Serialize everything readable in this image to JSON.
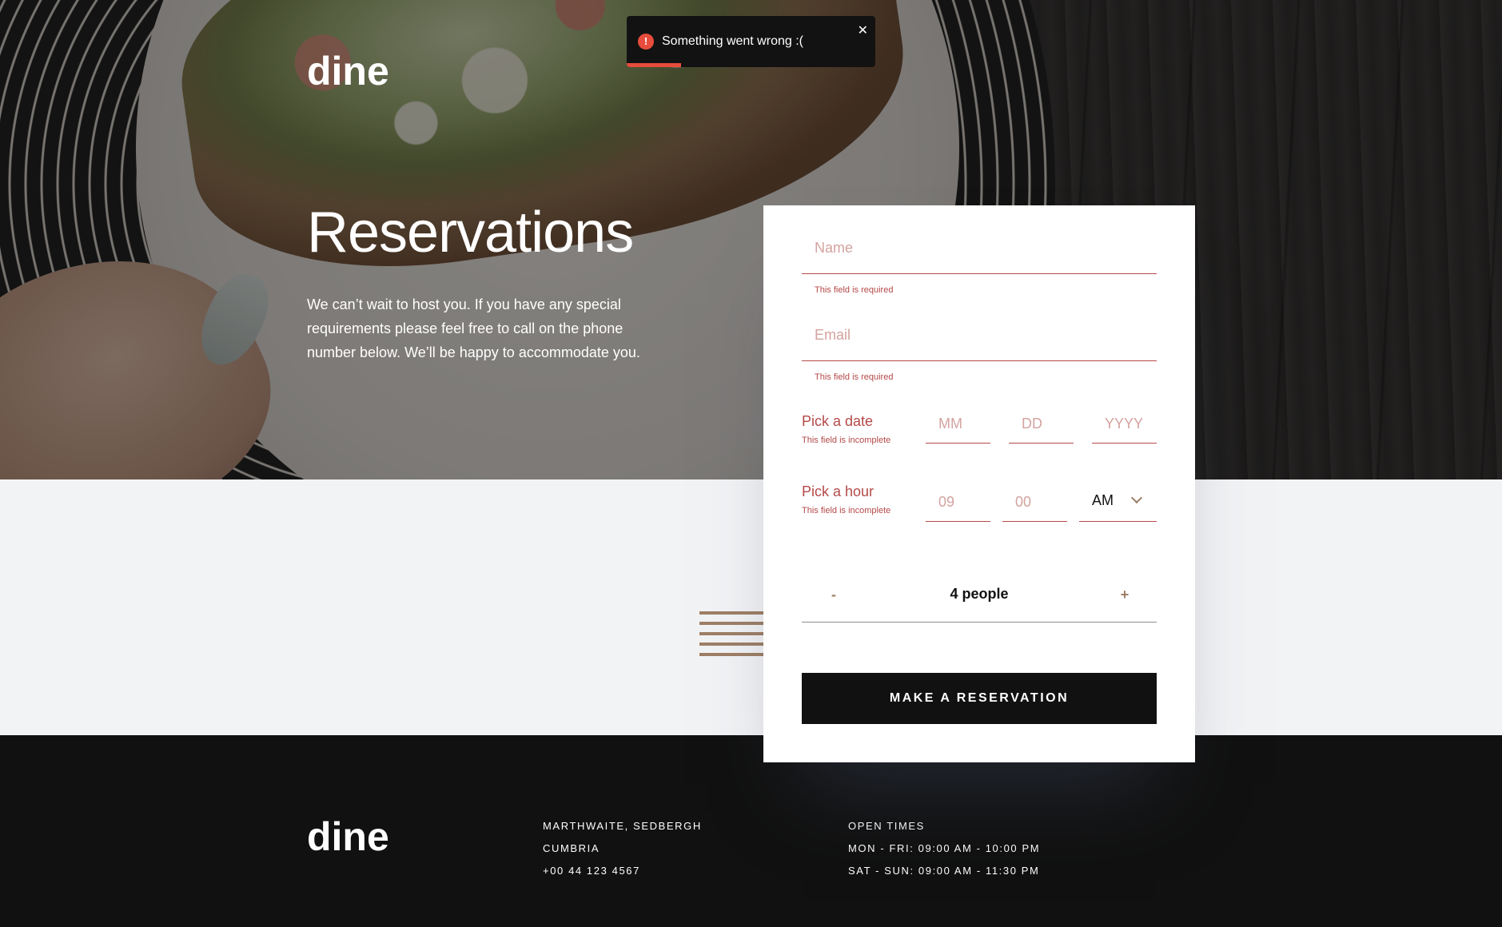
{
  "brand": {
    "logo": "dine"
  },
  "hero": {
    "title": "Reservations",
    "description": "We can’t wait to host you. If you have any special requirements please feel free to call on the phone number below. We’ll be happy to accommodate you."
  },
  "toast": {
    "message": "Something went wrong :(",
    "icon": "alert-icon",
    "close_icon": "close-icon",
    "progress": 0.22,
    "accent_color": "#e74c3c"
  },
  "form": {
    "name": {
      "placeholder": "Name",
      "value": "",
      "error": "This field is required"
    },
    "email": {
      "placeholder": "Email",
      "value": "",
      "error": "This field is required"
    },
    "date": {
      "label": "Pick a date",
      "error": "This field is incomplete",
      "month_placeholder": "MM",
      "day_placeholder": "DD",
      "year_placeholder": "YYYY"
    },
    "hour": {
      "label": "Pick a hour",
      "error": "This field is incomplete",
      "hour_placeholder": "09",
      "minute_placeholder": "00",
      "period": "AM"
    },
    "people": {
      "decrement": "-",
      "count_label": "4 people",
      "increment": "+"
    },
    "submit_label": "MAKE A RESERVATION",
    "error_color": "#b54949",
    "accent_color": "#9e7f66"
  },
  "footer": {
    "address": [
      "MARTHWAITE, SEDBERGH",
      "CUMBRIA",
      "+00 44 123 4567"
    ],
    "open_times": [
      "OPEN TIMES",
      "MON - FRI: 09:00 AM - 10:00 PM",
      "SAT - SUN: 09:00 AM - 11:30 PM"
    ]
  }
}
